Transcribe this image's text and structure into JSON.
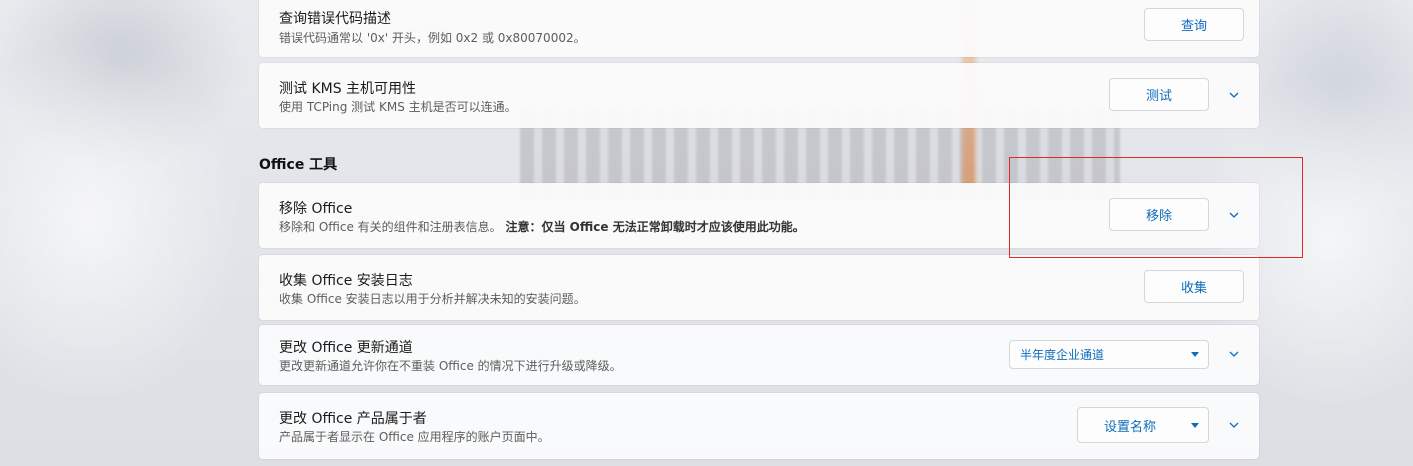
{
  "cards": [
    {
      "title": "查询错误代码描述",
      "desc": "错误代码通常以 '0x' 开头，例如 0x2 或 0x80070002。",
      "button": "查询"
    },
    {
      "title": "测试 KMS 主机可用性",
      "desc": "使用 TCPing 测试 KMS 主机是否可以连通。",
      "button": "测试"
    }
  ],
  "office_section": {
    "header": "Office 工具",
    "remove": {
      "title": "移除 Office",
      "desc": "移除和 Office 有关的组件和注册表信息。",
      "note": "注意：仅当 Office 无法正常卸载时才应该使用此功能。",
      "button": "移除"
    },
    "collect_logs": {
      "title": "收集 Office 安装日志",
      "desc": "收集 Office 安装日志以用于分析并解决未知的安装问题。",
      "button": "收集"
    },
    "update_channel": {
      "title": "更改 Office 更新通道",
      "desc": "更改更新通道允许你在不重装 Office 的情况下进行升级或降级。",
      "selected": "半年度企业通道"
    },
    "owner": {
      "title": "更改 Office 产品属于者",
      "desc": "产品属于者显示在 Office 应用程序的账户页面中。",
      "button": "设置名称"
    }
  },
  "colors": {
    "accent": "#0f6cbd",
    "highlight": "#e0292b"
  },
  "icons": {
    "chevron": "chevron-down-icon",
    "dropdown_caret": "caret-down-icon"
  }
}
